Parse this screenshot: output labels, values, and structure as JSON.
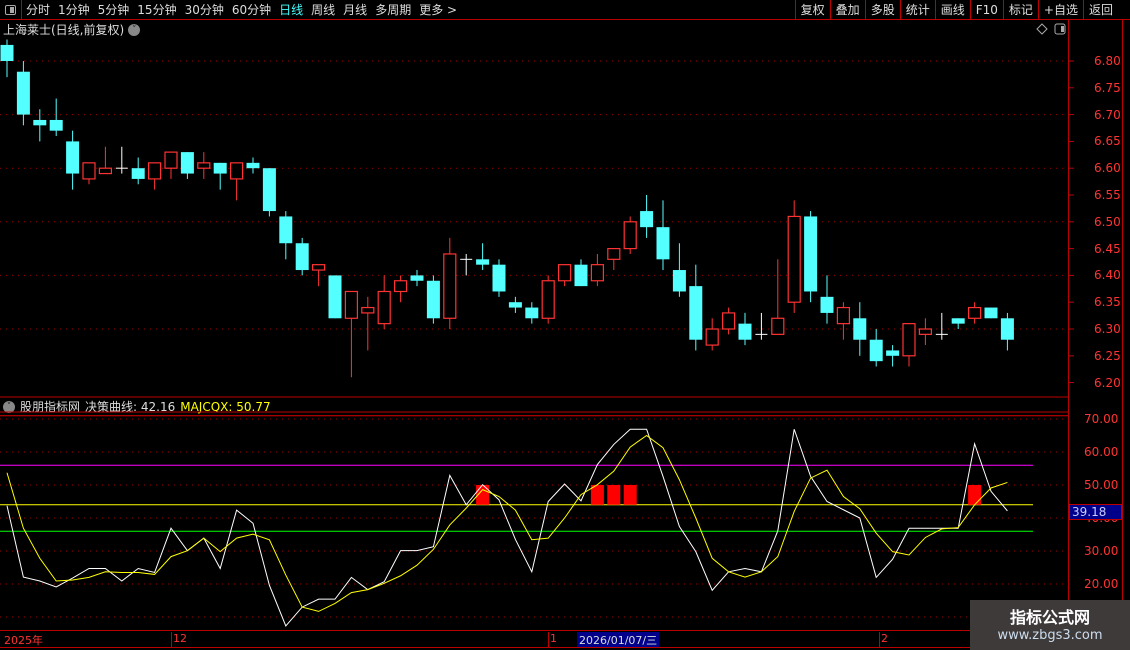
{
  "toolbar": {
    "periods": [
      "分时",
      "1分钟",
      "5分钟",
      "15分钟",
      "30分钟",
      "60分钟",
      "日线",
      "周线",
      "月线",
      "多周期",
      "更多 >"
    ],
    "active": "日线",
    "buttons": [
      "复权",
      "叠加",
      "多股",
      "统计",
      "画线",
      "F10",
      "标记",
      "+自选",
      "返回"
    ]
  },
  "chart": {
    "title": "上海莱士(日线,前复权)",
    "price_ticks": [
      "6.80",
      "6.75",
      "6.70",
      "6.65",
      "6.60",
      "6.55",
      "6.50",
      "6.45",
      "6.40",
      "6.35",
      "6.30",
      "6.25",
      "6.20"
    ]
  },
  "indicator": {
    "source": "股朋指标网",
    "line1_label": "决策曲线: 42.16",
    "line2_label": "MAJCQX: 50.77",
    "ticks": [
      "70.00",
      "60.00",
      "50.00",
      "40.00",
      "30.00",
      "20.00"
    ],
    "current_value": "39.18"
  },
  "date_axis": {
    "labels": [
      "2025年",
      "12",
      "1",
      "2"
    ],
    "selected": "2026/01/07/三"
  },
  "watermark": {
    "title": "指标公式网",
    "url": "www.zbgs3.com"
  },
  "colors": {
    "up": "#ff3333",
    "down": "#54ffff",
    "doji": "#ffffff",
    "line1": "#ffffff",
    "line2": "#ffff00",
    "signal": "#ff0000"
  },
  "chart_data": {
    "type": "candlestick",
    "ylim": [
      6.18,
      6.85
    ],
    "ohlc": [
      [
        6.83,
        6.84,
        6.77,
        6.8
      ],
      [
        6.78,
        6.8,
        6.68,
        6.7
      ],
      [
        6.69,
        6.71,
        6.65,
        6.68
      ],
      [
        6.69,
        6.73,
        6.66,
        6.67
      ],
      [
        6.65,
        6.67,
        6.56,
        6.59
      ],
      [
        6.58,
        6.61,
        6.57,
        6.61
      ],
      [
        6.59,
        6.64,
        6.59,
        6.6
      ],
      [
        6.6,
        6.64,
        6.59,
        6.6
      ],
      [
        6.6,
        6.62,
        6.57,
        6.58
      ],
      [
        6.58,
        6.61,
        6.56,
        6.61
      ],
      [
        6.6,
        6.63,
        6.58,
        6.63
      ],
      [
        6.63,
        6.63,
        6.58,
        6.59
      ],
      [
        6.6,
        6.63,
        6.58,
        6.61
      ],
      [
        6.61,
        6.61,
        6.56,
        6.59
      ],
      [
        6.58,
        6.61,
        6.54,
        6.61
      ],
      [
        6.61,
        6.62,
        6.59,
        6.6
      ],
      [
        6.6,
        6.6,
        6.51,
        6.52
      ],
      [
        6.51,
        6.52,
        6.43,
        6.46
      ],
      [
        6.46,
        6.47,
        6.4,
        6.41
      ],
      [
        6.41,
        6.42,
        6.38,
        6.42
      ],
      [
        6.4,
        6.4,
        6.32,
        6.32
      ],
      [
        6.32,
        6.37,
        6.21,
        6.37
      ],
      [
        6.33,
        6.36,
        6.26,
        6.34
      ],
      [
        6.31,
        6.4,
        6.3,
        6.37
      ],
      [
        6.37,
        6.4,
        6.35,
        6.39
      ],
      [
        6.4,
        6.41,
        6.38,
        6.39
      ],
      [
        6.39,
        6.4,
        6.31,
        6.32
      ],
      [
        6.32,
        6.47,
        6.3,
        6.44
      ],
      [
        6.43,
        6.44,
        6.4,
        6.43
      ],
      [
        6.43,
        6.46,
        6.41,
        6.42
      ],
      [
        6.42,
        6.43,
        6.36,
        6.37
      ],
      [
        6.35,
        6.36,
        6.33,
        6.34
      ],
      [
        6.34,
        6.35,
        6.31,
        6.32
      ],
      [
        6.32,
        6.4,
        6.31,
        6.39
      ],
      [
        6.39,
        6.42,
        6.38,
        6.42
      ],
      [
        6.42,
        6.43,
        6.38,
        6.38
      ],
      [
        6.39,
        6.44,
        6.38,
        6.42
      ],
      [
        6.43,
        6.45,
        6.41,
        6.45
      ],
      [
        6.45,
        6.51,
        6.44,
        6.5
      ],
      [
        6.52,
        6.55,
        6.47,
        6.49
      ],
      [
        6.49,
        6.54,
        6.41,
        6.43
      ],
      [
        6.41,
        6.46,
        6.36,
        6.37
      ],
      [
        6.38,
        6.42,
        6.26,
        6.28
      ],
      [
        6.27,
        6.32,
        6.26,
        6.3
      ],
      [
        6.3,
        6.34,
        6.29,
        6.33
      ],
      [
        6.31,
        6.33,
        6.27,
        6.28
      ],
      [
        6.29,
        6.33,
        6.28,
        6.29
      ],
      [
        6.29,
        6.43,
        6.29,
        6.32
      ],
      [
        6.35,
        6.54,
        6.33,
        6.51
      ],
      [
        6.51,
        6.52,
        6.35,
        6.37
      ],
      [
        6.36,
        6.4,
        6.31,
        6.33
      ],
      [
        6.31,
        6.35,
        6.28,
        6.34
      ],
      [
        6.32,
        6.35,
        6.25,
        6.28
      ],
      [
        6.28,
        6.3,
        6.23,
        6.24
      ],
      [
        6.26,
        6.27,
        6.23,
        6.25
      ],
      [
        6.25,
        6.31,
        6.23,
        6.31
      ],
      [
        6.29,
        6.32,
        6.27,
        6.3
      ],
      [
        6.29,
        6.33,
        6.28,
        6.29
      ],
      [
        6.32,
        6.32,
        6.3,
        6.31
      ],
      [
        6.32,
        6.35,
        6.31,
        6.34
      ],
      [
        6.34,
        6.34,
        6.32,
        6.32
      ],
      [
        6.32,
        6.33,
        6.26,
        6.28
      ]
    ],
    "indicator": {
      "ylim": [
        5,
        75
      ],
      "levels": [
        {
          "value": 71,
          "color": "#dd0000"
        },
        {
          "value": 56,
          "color": "#ff00ff"
        },
        {
          "value": 44,
          "color": "#ffff00"
        },
        {
          "value": 36,
          "color": "#00ff00"
        }
      ],
      "line1": [
        43.7,
        22.1,
        20.9,
        19.1,
        21.8,
        24.7,
        24.7,
        20.9,
        24.7,
        23.5,
        36.9,
        30.1,
        33.9,
        24.7,
        42.4,
        38.4,
        19.6,
        7.3,
        13.0,
        15.4,
        15.4,
        22.0,
        18.3,
        20.7,
        30.1,
        30.1,
        31.3,
        52.9,
        44.0,
        50.1,
        45.5,
        33.5,
        23.7,
        45.0,
        50.3,
        45.2,
        56.2,
        62.3,
        66.9,
        66.9,
        52.6,
        37.4,
        29.8,
        18.1,
        23.7,
        24.7,
        23.7,
        36.1,
        66.9,
        52.6,
        45.0,
        42.5,
        40.0,
        22.0,
        27.5,
        36.9,
        36.9,
        36.9,
        36.9,
        62.5,
        48.1,
        42.16
      ],
      "line2": [
        53.7,
        36.9,
        27.8,
        20.9,
        21.2,
        22.0,
        23.7,
        23.5,
        23.5,
        22.9,
        28.3,
        30.1,
        33.9,
        29.8,
        33.9,
        35.1,
        33.4,
        22.7,
        13.0,
        11.7,
        14.1,
        17.4,
        18.3,
        20.2,
        22.5,
        25.7,
        30.5,
        37.9,
        43.0,
        48.6,
        46.5,
        42.4,
        33.4,
        33.9,
        40.0,
        47.1,
        50.1,
        54.2,
        61.5,
        65.0,
        61.3,
        51.6,
        40.0,
        27.8,
        23.7,
        22.1,
        23.7,
        28.3,
        42.0,
        52.1,
        54.5,
        46.5,
        42.8,
        35.4,
        29.8,
        28.8,
        34.1,
        36.7,
        37.1,
        44.0,
        49.1,
        50.77
      ],
      "signals": [
        29,
        36,
        37,
        38,
        59
      ],
      "signal_range": [
        44,
        50
      ]
    }
  }
}
